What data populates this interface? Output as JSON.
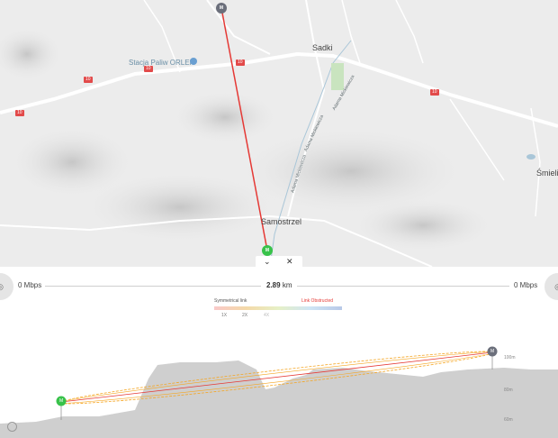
{
  "map": {
    "town_sadki": "Sadki",
    "town_samostrzel": "Samostrzel",
    "town_smiel": "Śmieli",
    "poi": "Stacja Paliw ORLEN",
    "road_number": "10",
    "street_1": "Adama Mickiewicza",
    "street_2": "Adama Mickiewicza",
    "street_3": "Adama Mickiewicza"
  },
  "nodes": {
    "top": "M",
    "bottom": "M"
  },
  "controls": {
    "collapse": "⌄",
    "close": "✕"
  },
  "link": {
    "left_speed": "0 Mbps",
    "right_speed": "0 Mbps",
    "distance_value": "2.89",
    "distance_unit": "km"
  },
  "legend": {
    "symmetrical": "Symmetrical link",
    "obstructed": "Link Obstructed",
    "ticks": [
      "1X",
      "2X",
      "4X"
    ]
  },
  "profile": {
    "right_label": "100m",
    "mid_labels": [
      "80m",
      "60m"
    ],
    "left_node": "M",
    "right_node": "M"
  },
  "colors": {
    "link_line": "#e53935",
    "fresnel": "#f5a623",
    "terrain": "#cfcfcf",
    "node_green": "#38c24a",
    "node_grey": "#6b6f7b"
  }
}
